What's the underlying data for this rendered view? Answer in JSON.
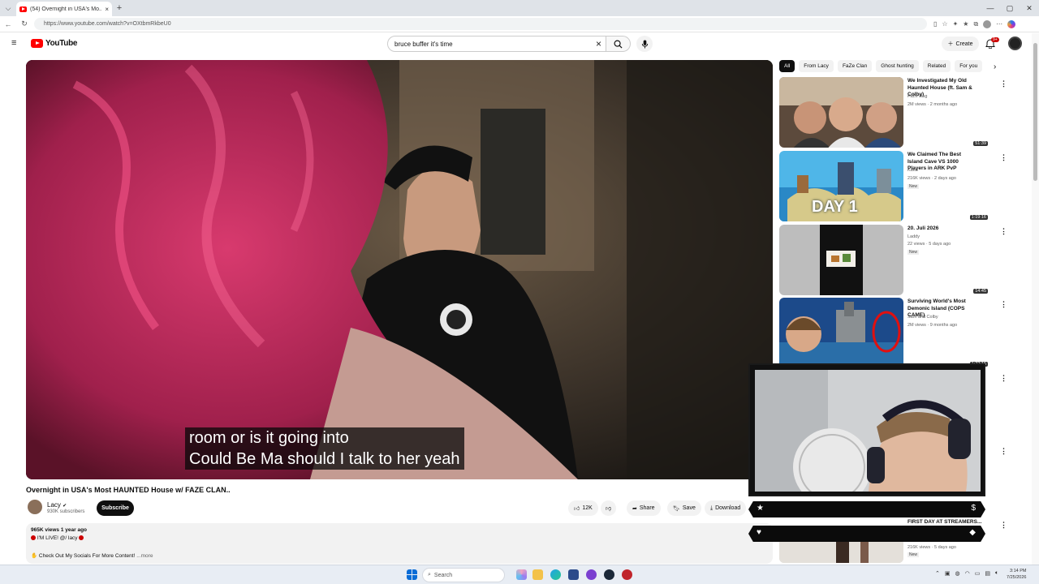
{
  "browser": {
    "tab_title": "(54) Overnight in USA's Mo...",
    "url": "https://www.youtube.com/watch?v=OXtbmRkbeU0",
    "tab_list_icon": "chevron-down-icon",
    "new_tab": "+",
    "close_tab": "×"
  },
  "youtube": {
    "logo_text": "YouTube",
    "search_query": "bruce buffer it's time",
    "create_label": "Create",
    "notifications_count": "9+"
  },
  "video": {
    "caption_line1": "room or is it going into",
    "caption_line2": "Could Be Ma should I talk to her yeah",
    "title": "Overnight in USA's Most HAUNTED House w/ FAZE CLAN..",
    "channel_name": "Lacy",
    "subscribers": "930K subscribers",
    "subscribe_label": "Subscribe",
    "likes": "12K",
    "share_label": "Share",
    "save_label": "Save",
    "download_label": "Download"
  },
  "description": {
    "views_date": "965K views  1 year ago",
    "line2": "I'M LIVE! @/ lacy",
    "line3": "Check Out My Socials For More Content!",
    "more": "...more"
  },
  "chips": [
    "All",
    "From Lacy",
    "FaZe Clan",
    "Ghost hunting",
    "Related",
    "For you"
  ],
  "recommendations": [
    {
      "title": "We Investigated My Old Haunted House (ft. Sam & Colby)",
      "channel": "FaZe Rug",
      "meta": "2M views · 2 months ago",
      "duration": "51:39",
      "badge": ""
    },
    {
      "title": "We Claimed The Best Island Cave VS 1000 Players in ARK PvP",
      "channel": "Kaen",
      "meta": "216K views · 2 days ago",
      "duration": "1:19:16",
      "badge": "New",
      "thumb_text": "DAY 1"
    },
    {
      "title": "20. Juli 2026",
      "channel": "Laddy",
      "meta": "22 views · 5 days ago",
      "duration": "14:45",
      "badge": "New"
    },
    {
      "title": "Surviving World's Most Demonic Island (COPS CAME)",
      "channel": "Sam and Colby",
      "meta": "2M views · 9 months ago",
      "duration": "1:22:16",
      "badge": ""
    }
  ],
  "hidden_rec": {
    "title": "FIRST DAY AT STREAMERS...",
    "meta": "216K views · 5 days ago",
    "badge": "New"
  },
  "taskbar": {
    "search_placeholder": "Search",
    "time": "3:14 PM",
    "date": "7/25/2026"
  }
}
